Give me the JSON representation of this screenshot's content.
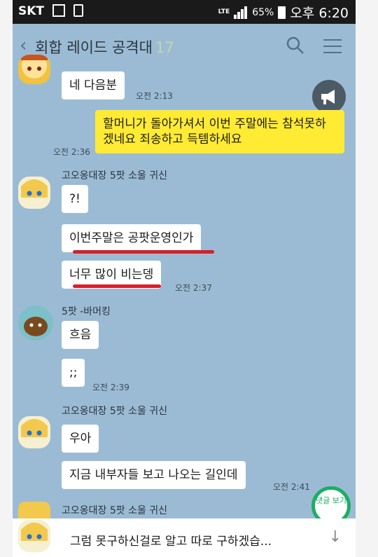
{
  "status": {
    "carrier": "SKT",
    "network": "LTE",
    "battery": "65%",
    "time": "오후 6:20"
  },
  "chat": {
    "title": "회합 레이드 공격대",
    "member_count": "17"
  },
  "messages": [
    {
      "text": "네 다음분",
      "time": "오전 2:13"
    },
    {
      "text": "할머니가 돌아가셔서 이번 주말에는 참석못하겠네요 죄송하고 득템하세요",
      "time": "오전 2:36"
    },
    {
      "sender": "고오옹대장 5팟 소울 귀신",
      "text": "?!"
    },
    {
      "text": "이번주말은 공팟운영인가"
    },
    {
      "text": "너무 많이 비는뎅",
      "time": "오전 2:37"
    },
    {
      "sender": "5팟 -바머킹",
      "text": "흐음"
    },
    {
      "text": ";;",
      "time": "오전 2:39"
    },
    {
      "sender": "고오옹대장 5팟 소울 귀신",
      "text": "우아"
    },
    {
      "text": "지금 내부자들 보고 나오는 길인데",
      "time": "오전 2:41"
    },
    {
      "sender": "고오옹대장 5팟 소울 귀신"
    }
  ],
  "reply_button": "댓글 보기",
  "preview": "그럼 못구하신걸로 알고 따로 구하겠습...",
  "icons": [
    "back-icon",
    "search-icon",
    "menu-icon",
    "megaphone-icon",
    "down-arrow-icon"
  ],
  "colors": {
    "chat_bg": "#9bbbd4",
    "my_bubble": "#ffeb33",
    "underline": "#d5202a",
    "reply_ring": "#1bae65"
  }
}
